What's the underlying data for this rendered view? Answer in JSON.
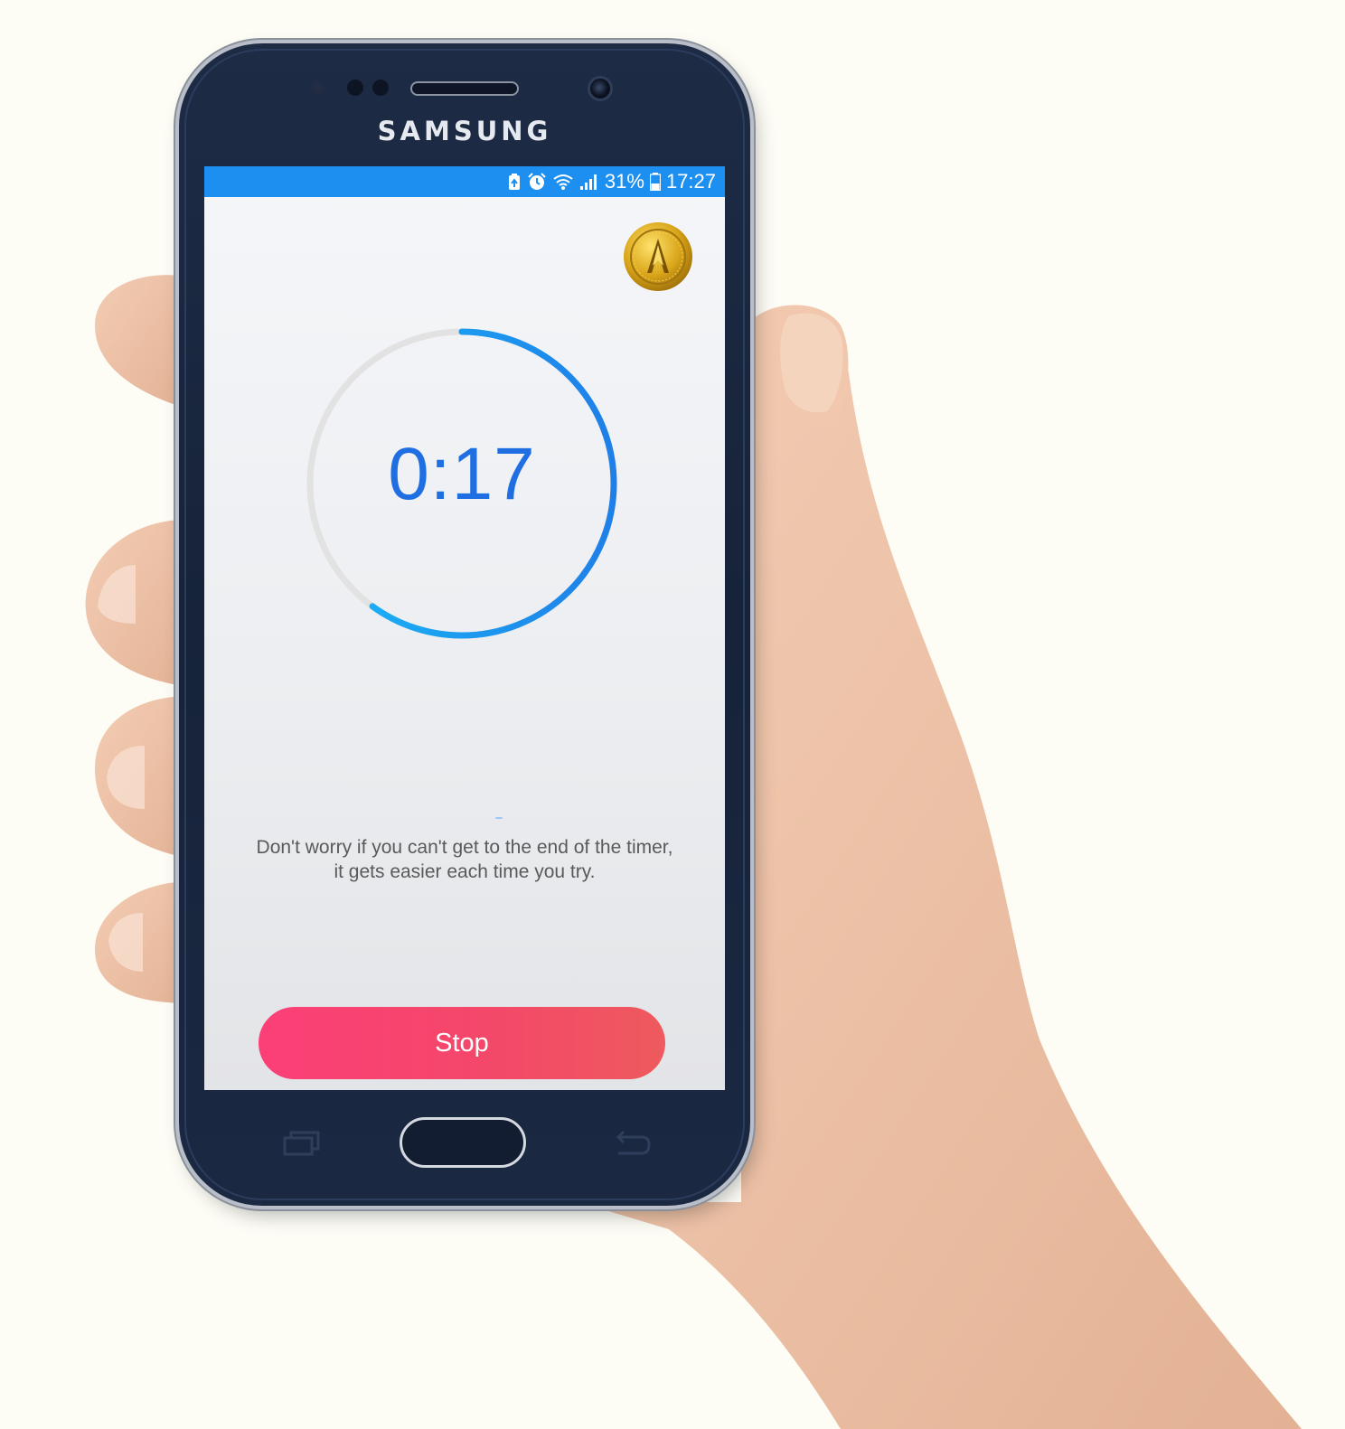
{
  "device": {
    "brand": "SAMSUNG"
  },
  "status_bar": {
    "battery": "31%",
    "time": "17:27",
    "icons": [
      "battery-saver-icon",
      "alarm-icon",
      "wifi-icon",
      "signal-icon",
      "battery-icon"
    ],
    "color": "#1d8ff0"
  },
  "app": {
    "badge_icon": "gold-coin-icon",
    "timer": {
      "display": "0:17",
      "progress": 0.6,
      "track_color": "#e2e2e2",
      "progress_color": "#1aa0f5"
    },
    "message": {
      "line1": "Don't worry if you can't get to the end of the timer,",
      "line2": "it gets easier each time you try."
    },
    "stop_button": {
      "label": "Stop",
      "color": "#f4476a"
    }
  },
  "nav_bar": {
    "recent_icon": "recent-apps-icon",
    "home_icon": "home-button",
    "back_icon": "back-icon"
  }
}
